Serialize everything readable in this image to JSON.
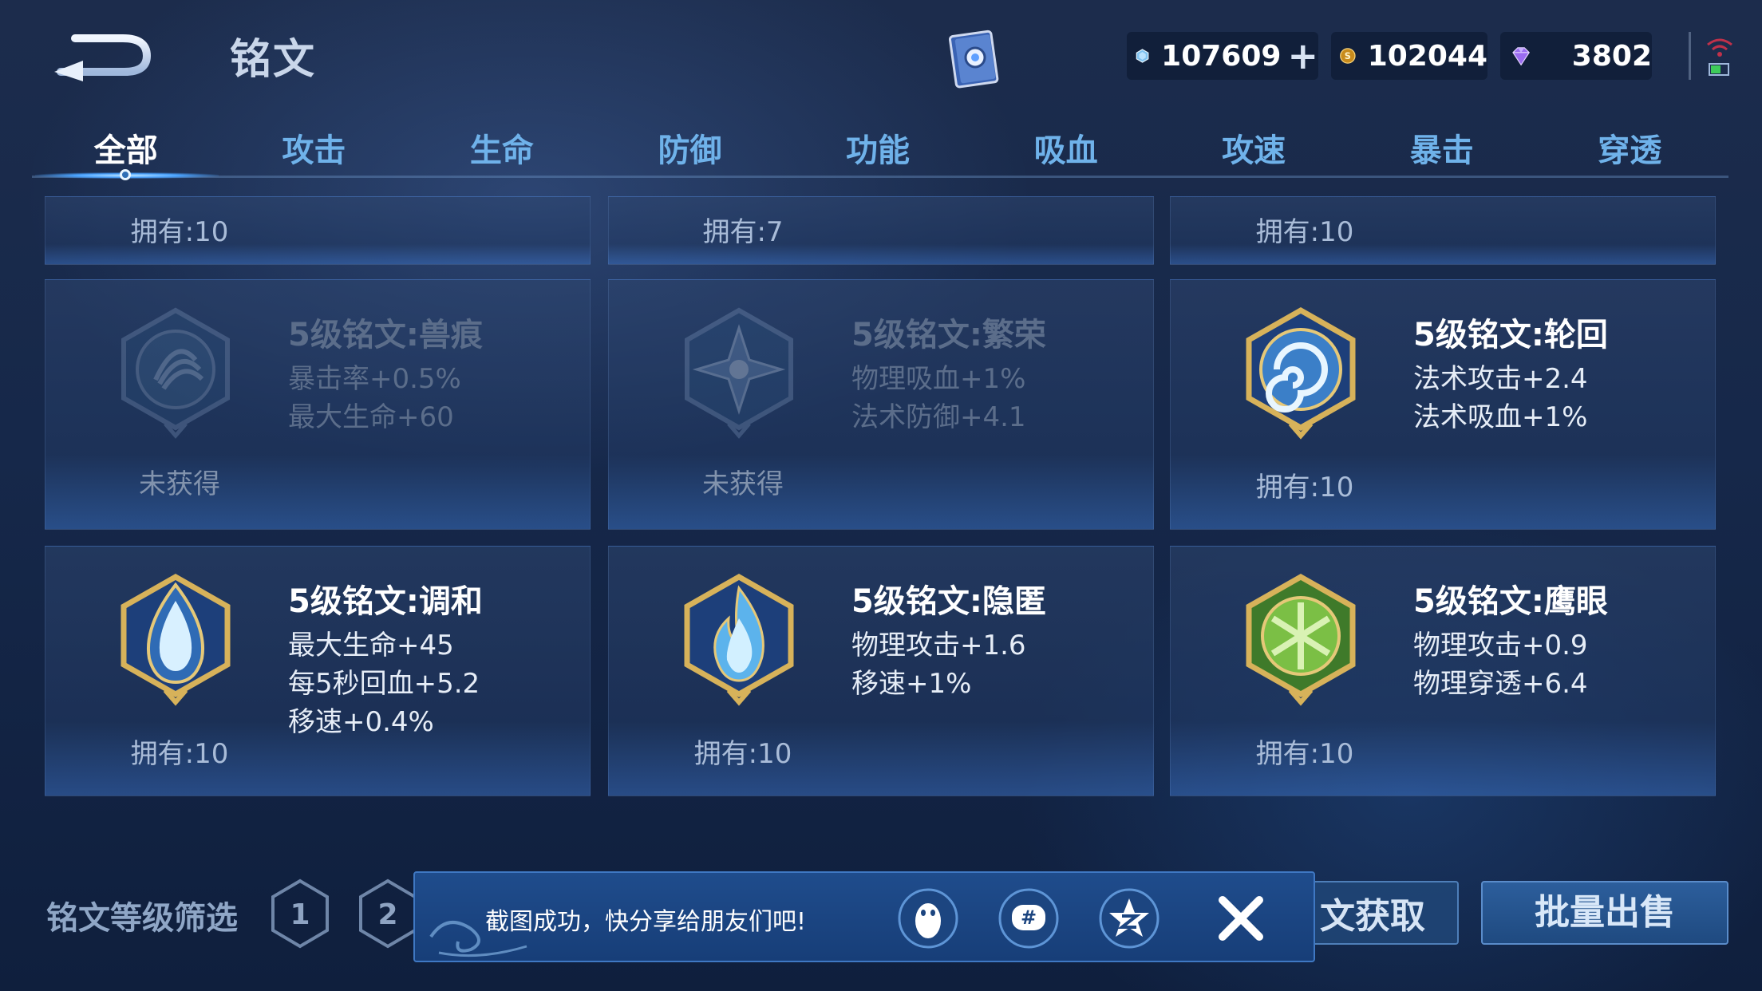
{
  "header": {
    "back_icon": "back-arrow-icon",
    "title": "铭文",
    "book_icon": "rune-book-icon",
    "currencies": [
      {
        "name": "diamond",
        "icon": "diamond-icon",
        "value": "107609",
        "has_plus": true
      },
      {
        "name": "coin",
        "icon": "gold-coin-icon",
        "value": "102044"
      },
      {
        "name": "gem",
        "icon": "purple-gem-icon",
        "value": "3802"
      }
    ],
    "status_icon": "wifi-battery-icon"
  },
  "tabs": [
    {
      "label": "全部",
      "active": true
    },
    {
      "label": "攻击"
    },
    {
      "label": "生命"
    },
    {
      "label": "防御"
    },
    {
      "label": "功能"
    },
    {
      "label": "吸血"
    },
    {
      "label": "攻速"
    },
    {
      "label": "暴击"
    },
    {
      "label": "穿透"
    }
  ],
  "cards": [
    {
      "row": 0,
      "col": 0,
      "owned": "拥有:10"
    },
    {
      "row": 0,
      "col": 1,
      "owned": "拥有:7"
    },
    {
      "row": 0,
      "col": 2,
      "owned": "拥有:10"
    },
    {
      "row": 1,
      "col": 0,
      "name": "5级铭文:兽痕",
      "stats": [
        "暴击率+0.5%",
        "最大生命+60"
      ],
      "owned": "未获得",
      "dim": true,
      "emblem": "claw-rune-icon"
    },
    {
      "row": 1,
      "col": 1,
      "name": "5级铭文:繁荣",
      "stats": [
        "物理吸血+1%",
        "法术防御+4.1"
      ],
      "owned": "未获得",
      "dim": true,
      "emblem": "star-rune-icon"
    },
    {
      "row": 1,
      "col": 2,
      "name": "5级铭文:轮回",
      "stats": [
        "法术攻击+2.4",
        "法术吸血+1%"
      ],
      "owned": "拥有:10",
      "emblem": "swirl-rune-icon"
    },
    {
      "row": 2,
      "col": 0,
      "name": "5级铭文:调和",
      "stats": [
        "最大生命+45",
        "每5秒回血+5.2",
        "移速+0.4%"
      ],
      "owned": "拥有:10",
      "emblem": "drop-rune-icon"
    },
    {
      "row": 2,
      "col": 1,
      "name": "5级铭文:隐匿",
      "stats": [
        "物理攻击+1.6",
        "移速+1%"
      ],
      "owned": "拥有:10",
      "emblem": "flame-rune-icon"
    },
    {
      "row": 2,
      "col": 2,
      "name": "5级铭文:鹰眼",
      "stats": [
        "物理攻击+0.9",
        "物理穿透+6.4"
      ],
      "owned": "拥有:10",
      "emblem": "eagle-rune-icon"
    }
  ],
  "bottom": {
    "filter_label": "铭文等级筛选",
    "level_badges": [
      "1",
      "2"
    ],
    "acquire_label": "文获取",
    "sell_label": "批量出售"
  },
  "toast": {
    "message": "截图成功，快分享给朋友们吧!",
    "share_icons": [
      "qq-penguin-icon",
      "wechat-moments-icon",
      "qzone-star-icon"
    ],
    "close_icon": "close-icon"
  },
  "colors": {
    "background": "#16284a",
    "tab_inactive": "#6fb2ea",
    "tab_active": "#ffffff",
    "accent_blue": "#4aa3ff"
  }
}
